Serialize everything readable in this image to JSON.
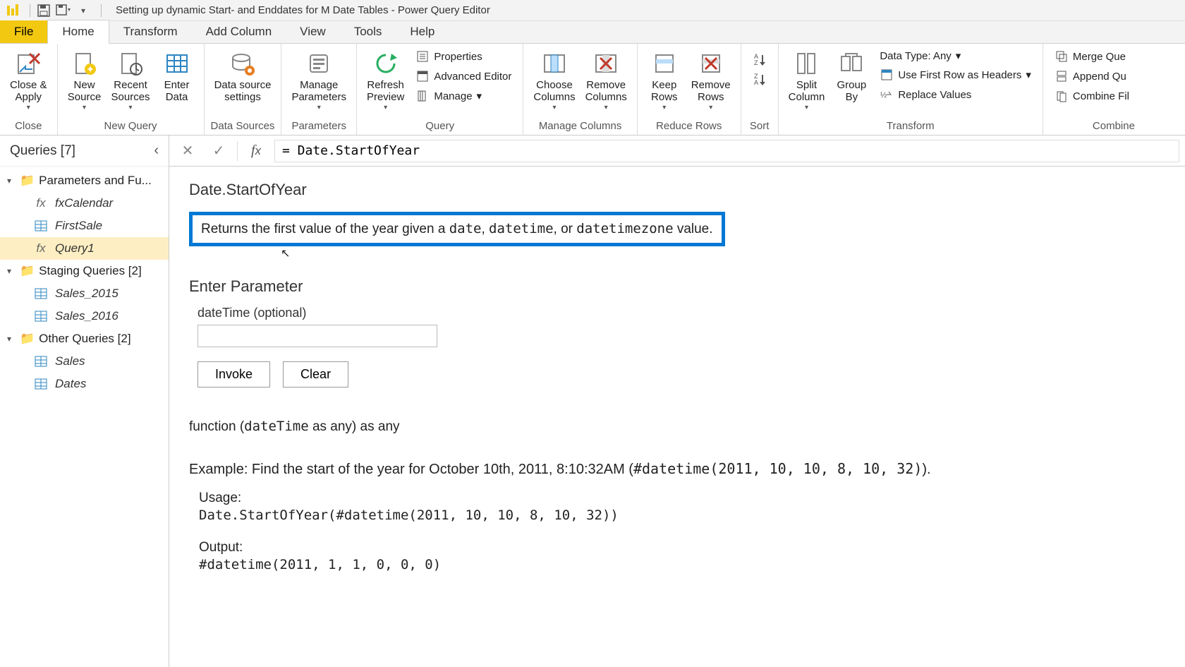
{
  "titlebar": {
    "title": "Setting up dynamic Start- and Enddates for M Date Tables - Power Query Editor"
  },
  "tabs": {
    "file": "File",
    "home": "Home",
    "transform": "Transform",
    "addcolumn": "Add Column",
    "view": "View",
    "tools": "Tools",
    "help": "Help"
  },
  "ribbon": {
    "close_apply": "Close &\nApply",
    "close_group": "Close",
    "new_source": "New\nSource",
    "recent_sources": "Recent\nSources",
    "enter_data": "Enter\nData",
    "new_query_group": "New Query",
    "data_source_settings": "Data source\nsettings",
    "data_sources_group": "Data Sources",
    "manage_parameters": "Manage\nParameters",
    "parameters_group": "Parameters",
    "refresh_preview": "Refresh\nPreview",
    "properties": "Properties",
    "advanced_editor": "Advanced Editor",
    "manage": "Manage",
    "query_group": "Query",
    "choose_columns": "Choose\nColumns",
    "remove_columns": "Remove\nColumns",
    "manage_columns_group": "Manage Columns",
    "keep_rows": "Keep\nRows",
    "remove_rows": "Remove\nRows",
    "reduce_rows_group": "Reduce Rows",
    "sort_group": "Sort",
    "split_column": "Split\nColumn",
    "group_by": "Group\nBy",
    "data_type": "Data Type: Any",
    "use_first_row": "Use First Row as Headers",
    "replace_values": "Replace Values",
    "transform_group": "Transform",
    "merge_queries": "Merge Que",
    "append_queries": "Append Qu",
    "combine_files": "Combine Fil",
    "combine_group": "Combine"
  },
  "queries": {
    "header": "Queries [7]",
    "group1": "Parameters and Fu...",
    "fxCalendar": "fxCalendar",
    "FirstSale": "FirstSale",
    "Query1": "Query1",
    "group2": "Staging Queries [2]",
    "Sales_2015": "Sales_2015",
    "Sales_2016": "Sales_2016",
    "group3": "Other Queries [2]",
    "Sales": "Sales",
    "Dates": "Dates"
  },
  "formula": {
    "text": "= Date.StartOfYear"
  },
  "func": {
    "name": "Date.StartOfYear",
    "desc_pre": "Returns the first value of the year given a ",
    "c1": "date",
    "desc_sep1": ", ",
    "c2": "datetime",
    "desc_sep2": ", or ",
    "c3": "datetimezone",
    "desc_post": " value.",
    "enter_param": "Enter Parameter",
    "param_label": "dateTime (optional)",
    "invoke": "Invoke",
    "clear": "Clear",
    "sig_pre": "function (",
    "sig_code": "dateTime",
    "sig_post": " as any) as any",
    "example_pre": "Example: Find the start of the year for October 10th, 2011, 8:10:32AM (",
    "example_code": "#datetime",
    "example_args": "(2011, 10, 10, 8, 10, 32)",
    "example_post": ").",
    "usage_label": "Usage:",
    "usage_code": "Date.StartOfYear(#datetime(2011, 10, 10, 8, 10, 32))",
    "output_label": "Output:",
    "output_code": "#datetime(2011, 1, 1, 0, 0, 0)"
  }
}
